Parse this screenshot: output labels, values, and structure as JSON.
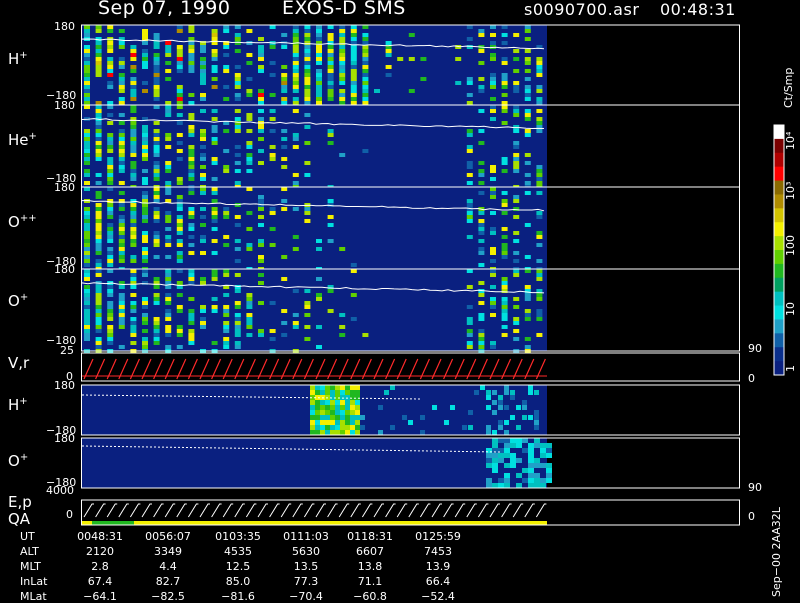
{
  "header": {
    "date": "Sep 07, 1990",
    "instrument": "EXOS-D SMS",
    "file": "s0090700.asr",
    "time": "00:48:31"
  },
  "panels": [
    {
      "label": "H",
      "sup": "+",
      "ymax": "180",
      "ymin": "−180"
    },
    {
      "label": "He",
      "sup": "+",
      "ymax": "180",
      "ymin": "−180"
    },
    {
      "label": "O",
      "sup": "++",
      "ymax": "180",
      "ymin": "−180"
    },
    {
      "label": "O",
      "sup": "+",
      "ymax": "180",
      "ymin": "−180"
    },
    {
      "label": "V,r",
      "sup": "",
      "ymax": "25",
      "ymin": "0",
      "rmax": "90",
      "rmin": "0"
    },
    {
      "label": "H",
      "sup": "+",
      "ymax": "180",
      "ymin": "−180"
    },
    {
      "label": "O",
      "sup": "+",
      "ymax": "180",
      "ymin": "−180"
    },
    {
      "label": "E,p",
      "label2": "QA",
      "ymax": "4000",
      "ymin": "0",
      "rmax": "90",
      "rmin": "0"
    }
  ],
  "colorbar": {
    "unit": "Ct/Smp",
    "ticks": [
      "10⁴",
      "10³",
      "100",
      "10",
      "1"
    ],
    "colors": [
      "#ffffff",
      "#7a0000",
      "#b00000",
      "#ff0000",
      "#8a6a00",
      "#b08c00",
      "#d4c400",
      "#f4f000",
      "#a8e000",
      "#60d000",
      "#20b820",
      "#00a060",
      "#00c0c0",
      "#00e0e0",
      "#20a0c8",
      "#1060a8",
      "#0a2f8c",
      "#0a2080"
    ]
  },
  "table": {
    "rows": [
      {
        "label": "UT",
        "values": [
          "0048:31",
          "0056:07",
          "0103:35",
          "0111:03",
          "0118:31",
          "0125:59"
        ]
      },
      {
        "label": "ALT",
        "values": [
          "2120",
          "3349",
          "4535",
          "5630",
          "6607",
          "7453"
        ]
      },
      {
        "label": "MLT",
        "values": [
          "2.8",
          "4.4",
          "12.5",
          "13.5",
          "13.8",
          "13.9"
        ]
      },
      {
        "label": "InLat",
        "values": [
          "67.4",
          "82.7",
          "85.0",
          "77.3",
          "71.1",
          "66.4"
        ]
      },
      {
        "label": "MLat",
        "values": [
          "−64.1",
          "−82.5",
          "−81.6",
          "−70.4",
          "−60.8",
          "−52.4"
        ]
      }
    ]
  },
  "side_label": "Sep−00 2AA32L",
  "chart_data": {
    "type": "heatmap",
    "title": "Sep 07, 1990    EXOS-D SMS",
    "x_ticks_ut": [
      "0048:31",
      "0056:07",
      "0103:35",
      "0111:03",
      "0118:31",
      "0125:59"
    ],
    "panels": [
      "H+",
      "He+",
      "O++",
      "O+",
      "V,r",
      "H+",
      "O+",
      "E,p"
    ],
    "y_range_pitch": [
      -180,
      180
    ],
    "colorbar_scale": "log",
    "colorbar_range": [
      1,
      10000
    ],
    "colorbar_unit": "Ct/Smp"
  }
}
